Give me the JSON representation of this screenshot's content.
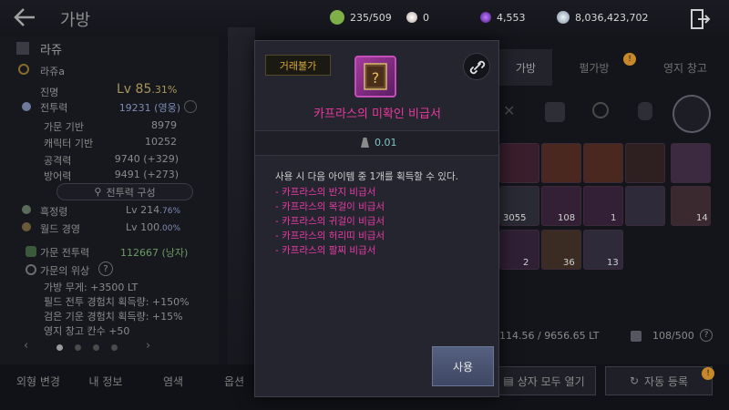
{
  "header": {
    "title": "가방",
    "currencies": [
      {
        "icon": "energy-icon",
        "value": "235/509",
        "color": "#7fb04a"
      },
      {
        "icon": "pearl-icon",
        "value": "0",
        "color": "#d8c8c0"
      },
      {
        "icon": "purple-gem-icon",
        "value": "4,553",
        "color": "#8b3fd1"
      },
      {
        "icon": "silver-coin-icon",
        "value": "8,036,423,702",
        "color": "#c9d6e3"
      }
    ]
  },
  "left_panel": {
    "name": "라쥬",
    "sub_name": "라쥬a",
    "rank_label": "진명",
    "level": "Lv 85",
    "level_pct": ".31%",
    "cp_label": "전투력",
    "cp_value": "19231 (영웅)",
    "stats": [
      {
        "label": "가문 기반",
        "value": "8979"
      },
      {
        "label": "캐릭터 기반",
        "value": "10252"
      },
      {
        "label": "공격력",
        "value": "9740 (+329)"
      },
      {
        "label": "방어력",
        "value": "9491 (+273)"
      }
    ],
    "cp_compose_button": "전투력 구성",
    "contrib_label": "흑정령",
    "contrib_value": "Lv 214",
    "contrib_pct": ".76%",
    "world_label": "월드 경영",
    "world_value": "Lv 100",
    "world_pct": ".00%",
    "family_cp_label": "가문 전투력",
    "family_cp_value": "112667 (낭자)",
    "family_status_label": "가문의 위상",
    "family_bonuses": [
      "가방 무게: +3500 LT",
      "필드 전투 경험치 획득량: +150%",
      "검은 기운 경험치 획득량: +15%",
      "영지 창고 칸수 +50"
    ]
  },
  "right_panel": {
    "tabs": [
      "가방",
      "펄가방",
      "영지 창고"
    ],
    "weight_text": "114.56 / 9656.65 LT",
    "slots_text": "108/500",
    "slot_counts": [
      "3055",
      "108",
      "1",
      "14",
      "2",
      "36",
      "13"
    ],
    "open_all_button": "상자 모두 열기",
    "auto_sell_button": "자동 등록"
  },
  "bottom_nav": {
    "items": [
      "외형 변경",
      "내 정보",
      "염색",
      "옵션"
    ]
  },
  "modal": {
    "tag": "거래불가",
    "item_name": "카프라스의 미확인 비급서",
    "weight": "0.01",
    "description": "사용 시 다음 아이템 중 1개를 획득할 수 있다.",
    "options": [
      "카프라스의 반지 비급서",
      "카프라스의 목걸이 비급서",
      "카프라스의 귀걸이 비급서",
      "카프라스의 허리띠 비급서",
      "카프라스의 팔찌 비급서"
    ],
    "use_button": "사용"
  },
  "colors": {
    "item_name": "#ea3aa0",
    "tag_text": "#d7a93c",
    "accent_level": "#a8955b"
  }
}
